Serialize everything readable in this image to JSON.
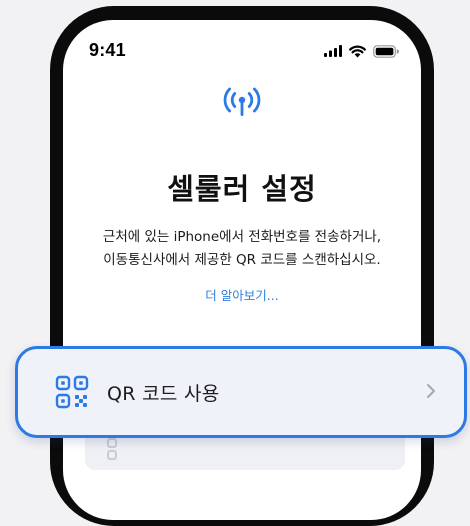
{
  "status_bar": {
    "time": "9:41"
  },
  "setup": {
    "title": "셀룰러 설정",
    "description_line1": "근처에 있는 iPhone에서 전화번호를 전송하거나,",
    "description_line2": "이동통신사에서 제공한 QR 코드를 스캔하십시오.",
    "learn_more": "더 알아보기..."
  },
  "qr_option": {
    "label": "QR 코드 사용",
    "icon": "qr-code-icon"
  },
  "colors": {
    "accent": "#2c7be5",
    "link": "#2d7fe0"
  }
}
